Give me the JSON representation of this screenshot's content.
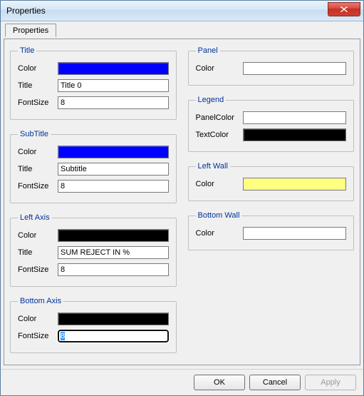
{
  "window": {
    "title": "Properties"
  },
  "tabs": [
    {
      "label": "Properties"
    }
  ],
  "groups": {
    "title": {
      "legend": "Title",
      "colorLabel": "Color",
      "color": "#0000ff",
      "titleLabel": "Title",
      "titleValue": "Title 0",
      "fontSizeLabel": "FontSize",
      "fontSizeValue": "8"
    },
    "subtitle": {
      "legend": "SubTitle",
      "colorLabel": "Color",
      "color": "#0000ff",
      "titleLabel": "Title",
      "titleValue": "Subtitle",
      "fontSizeLabel": "FontSize",
      "fontSizeValue": "8"
    },
    "leftAxis": {
      "legend": "Left Axis",
      "colorLabel": "Color",
      "color": "#000000",
      "titleLabel": "Title",
      "titleValue": "SUM REJECT IN %",
      "fontSizeLabel": "FontSize",
      "fontSizeValue": "8"
    },
    "bottomAxis": {
      "legend": "Bottom Axis",
      "colorLabel": "Color",
      "color": "#000000",
      "fontSizeLabel": "FontSize",
      "fontSizeValue": "8"
    },
    "panel": {
      "legend": "Panel",
      "colorLabel": "Color",
      "color": "#ffffff"
    },
    "legendGrp": {
      "legend": "Legend",
      "panelColorLabel": "PanelColor",
      "panelColor": "#ffffff",
      "textColorLabel": "TextColor",
      "textColor": "#000000"
    },
    "leftWall": {
      "legend": "Left Wall",
      "colorLabel": "Color",
      "color": "#ffff80"
    },
    "bottomWall": {
      "legend": "Bottom Wall",
      "colorLabel": "Color",
      "color": "#ffffff"
    }
  },
  "buttons": {
    "ok": "OK",
    "cancel": "Cancel",
    "apply": "Apply"
  }
}
